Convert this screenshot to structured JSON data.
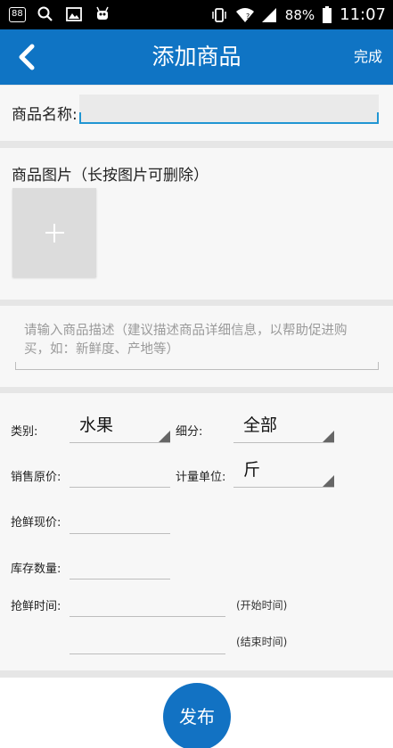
{
  "status_bar": {
    "notification_badge": "88",
    "battery": "88%",
    "time": "11:07",
    "icons": [
      "notification-count-icon",
      "search-icon",
      "image-icon",
      "android-robot-icon",
      "vibrate-icon",
      "wifi-icon",
      "signal-icon",
      "battery-icon"
    ]
  },
  "app_bar": {
    "title": "添加商品",
    "done_label": "完成",
    "background": "#0f74c4"
  },
  "product_name": {
    "label": "商品名称:",
    "value": ""
  },
  "product_images": {
    "label": "商品图片（长按图片可删除）",
    "add_icon": "plus-icon"
  },
  "description": {
    "placeholder": "请输入商品描述（建议描述商品详细信息，以帮助促进购买，如：新鲜度、产地等）",
    "value": ""
  },
  "form": {
    "category_label": "类别:",
    "category_value": "水果",
    "subcategory_label": "细分:",
    "subcategory_value": "全部",
    "original_price_label": "销售原价:",
    "original_price_value": "",
    "unit_label": "计量单位:",
    "unit_value": "斤",
    "sale_price_label": "抢鲜现价:",
    "sale_price_value": "",
    "stock_label": "库存数量:",
    "stock_value": "",
    "time_label": "抢鲜时间:",
    "start_time_value": "",
    "start_time_hint": "(开始时间)",
    "end_time_value": "",
    "end_time_hint": "(结束时间)"
  },
  "publish_label": "发布",
  "accent_color": "#1272c3"
}
